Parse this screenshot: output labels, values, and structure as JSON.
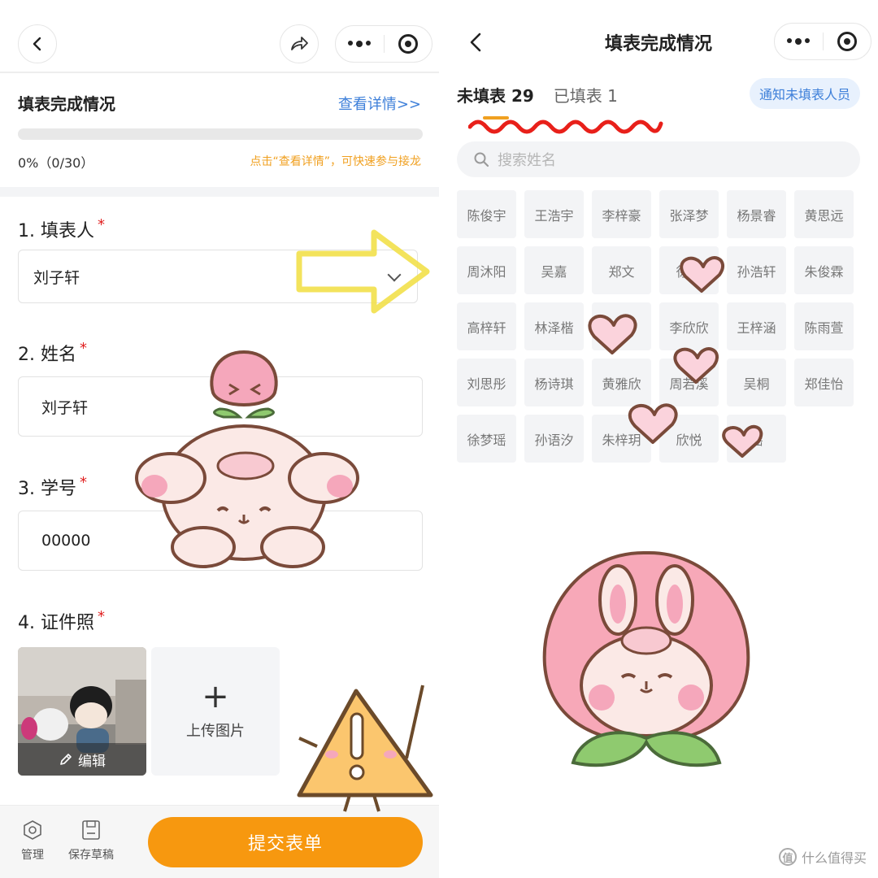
{
  "left": {
    "section": {
      "title": "填表完成情况",
      "detail_link": "查看详情>>",
      "progress": 0,
      "progress_text": "0%（0/30）",
      "hint": "点击“查看详情”，可快速参与接龙"
    },
    "questions": [
      {
        "label": "1. 填表人",
        "required": "*",
        "value": "刘子轩"
      },
      {
        "label": "2. 姓名",
        "required": "*",
        "value": "刘子轩"
      },
      {
        "label": "3. 学号",
        "required": "*",
        "value": "00000"
      },
      {
        "label": "4. 证件照",
        "required": "*"
      }
    ],
    "photo": {
      "edit_label": "编辑"
    },
    "upload": {
      "plus": "+",
      "label": "上传图片"
    },
    "bottom": {
      "manage": "管理",
      "save_draft": "保存草稿",
      "submit": "提交表单"
    }
  },
  "right": {
    "title": "填表完成情况",
    "tabs": [
      {
        "label": "未填表 29",
        "active": true
      },
      {
        "label": "已填表 1",
        "active": false
      }
    ],
    "notify_button": "通知未填表人员",
    "search_placeholder": "搜索姓名",
    "names": [
      "陈俊宇",
      "王浩宇",
      "李梓豪",
      "张泽梦",
      "杨景睿",
      "黄思远",
      "周沐阳",
      "吴嘉",
      "郑文",
      "徐铭",
      "孙浩轩",
      "朱俊霖",
      "高梓轩",
      "林泽楷",
      "张",
      "李欣欣",
      "王梓涵",
      "陈雨萱",
      "刘思彤",
      "杨诗琪",
      "黄雅欣",
      "周若溪",
      "吴桐",
      "郑佳怡",
      "徐梦瑶",
      "孙语汐",
      "朱梓玥",
      "欣悦",
      "瑶"
    ]
  },
  "watermark": {
    "symbol": "值",
    "text": "什么值得买"
  },
  "colors": {
    "accent_orange": "#f7980f",
    "link_blue": "#3d7fd9",
    "required_red": "#e02020",
    "hint_orange": "#f0a020"
  },
  "icons": [
    "back-arrow-icon",
    "share-icon",
    "more-dots-icon",
    "target-icon",
    "chevron-down-icon",
    "pencil-icon",
    "hexagon-icon",
    "save-icon",
    "search-icon"
  ]
}
